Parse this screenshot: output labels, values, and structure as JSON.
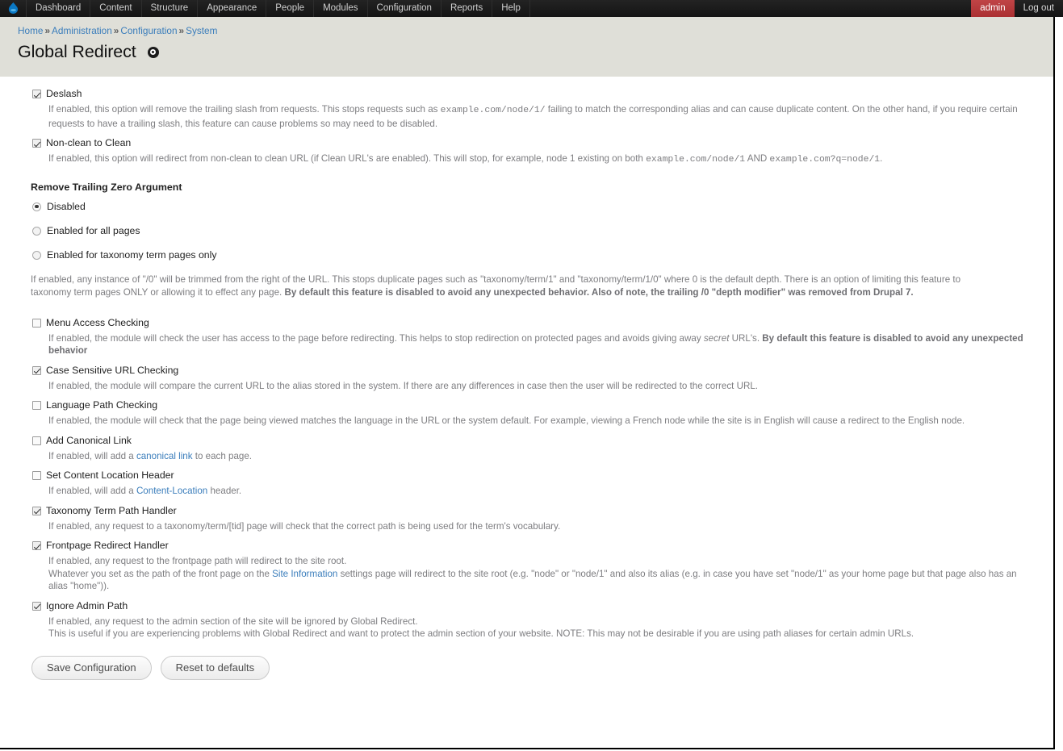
{
  "toolbar": {
    "logo_name": "drupal-droplet-logo",
    "menu": [
      "Dashboard",
      "Content",
      "Structure",
      "Appearance",
      "People",
      "Modules",
      "Configuration",
      "Reports",
      "Help"
    ],
    "user": "admin",
    "logout": "Log out",
    "user_badge_color": "#b7383a"
  },
  "breadcrumb": {
    "items": [
      "Home",
      "Administration",
      "Configuration",
      "System"
    ],
    "separator": "»"
  },
  "page": {
    "title": "Global Redirect"
  },
  "settings": {
    "deslash": {
      "label": "Deslash",
      "checked": true,
      "desc_1": "If enabled, this option will remove the trailing slash from requests. This stops requests such as ",
      "code_1": "example.com/node/1/",
      "desc_2": " failing to match the corresponding alias and can cause duplicate content. On the other hand, if you require certain requests to have a trailing slash, this feature can cause problems so may need to be disabled."
    },
    "nonclean": {
      "label": "Non-clean to Clean",
      "checked": true,
      "desc_1": "If enabled, this option will redirect from non-clean to clean URL (if Clean URL's are enabled). This will stop, for example, node 1 existing on both ",
      "code_1": "example.com/node/1",
      "desc_2": " AND ",
      "code_2": "example.com?q=node/1",
      "desc_3": "."
    },
    "trailing_zero": {
      "title": "Remove Trailing Zero Argument",
      "options": [
        {
          "label": "Disabled",
          "selected": true
        },
        {
          "label": "Enabled for all pages",
          "selected": false
        },
        {
          "label": "Enabled for taxonomy term pages only",
          "selected": false
        }
      ],
      "desc_1": "If enabled, any instance of \"/0\" will be trimmed from the right of the URL. This stops duplicate pages such as \"taxonomy/term/1\" and \"taxonomy/term/1/0\" where 0 is the default depth. There is an option of limiting this feature to taxonomy term pages ONLY or allowing it to effect any page. ",
      "desc_bold": "By default this feature is disabled to avoid any unexpected behavior. Also of note, the trailing /0 \"depth modifier\" was removed from Drupal 7."
    },
    "menu_access": {
      "label": "Menu Access Checking",
      "checked": false,
      "desc_1": "If enabled, the module will check the user has access to the page before redirecting. This helps to stop redirection on protected pages and avoids giving away ",
      "desc_italic": "secret",
      "desc_2": " URL's. ",
      "desc_bold": "By default this feature is disabled to avoid any unexpected behavior"
    },
    "case_sensitive": {
      "label": "Case Sensitive URL Checking",
      "checked": true,
      "desc": "If enabled, the module will compare the current URL to the alias stored in the system. If there are any differences in case then the user will be redirected to the correct URL."
    },
    "language_path": {
      "label": "Language Path Checking",
      "checked": false,
      "desc": "If enabled, the module will check that the page being viewed matches the language in the URL or the system default. For example, viewing a French node while the site is in English will cause a redirect to the English node."
    },
    "canonical": {
      "label": "Add Canonical Link",
      "checked": false,
      "desc_1": "If enabled, will add a ",
      "link": "canonical link",
      "desc_2": " to each page."
    },
    "content_location": {
      "label": "Set Content Location Header",
      "checked": false,
      "desc_1": "If enabled, will add a ",
      "link": "Content-Location",
      "desc_2": " header."
    },
    "taxonomy_handler": {
      "label": "Taxonomy Term Path Handler",
      "checked": true,
      "desc": "If enabled, any request to a taxonomy/term/[tid] page will check that the correct path is being used for the term's vocabulary."
    },
    "frontpage_handler": {
      "label": "Frontpage Redirect Handler",
      "checked": true,
      "desc_line1": "If enabled, any request to the frontpage path will redirect to the site root.",
      "desc_line2_a": "Whatever you set as the path of the front page on the ",
      "link": "Site Information",
      "desc_line2_b": " settings page will redirect to the site root (e.g. \"node\" or \"node/1\" and also its alias (e.g. in case you have set \"node/1\" as your home page but that page also has an alias \"home\"))."
    },
    "ignore_admin": {
      "label": "Ignore Admin Path",
      "checked": true,
      "desc_line1": "If enabled, any request to the admin section of the site will be ignored by Global Redirect.",
      "desc_line2": "This is useful if you are experiencing problems with Global Redirect and want to protect the admin section of your website. NOTE: This may not be desirable if you are using path aliases for certain admin URLs."
    }
  },
  "actions": {
    "save": "Save Configuration",
    "reset": "Reset to defaults"
  }
}
